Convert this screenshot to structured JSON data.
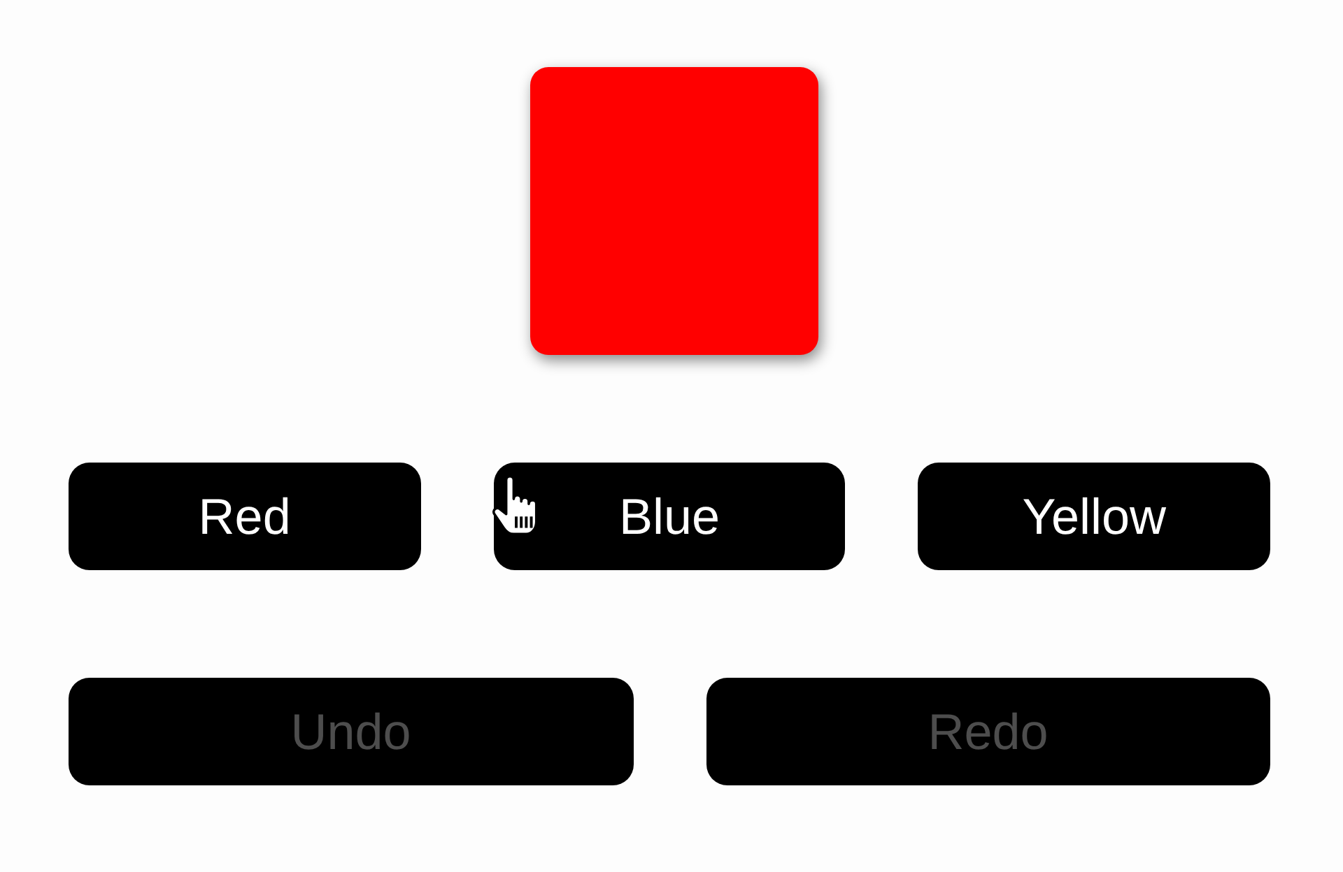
{
  "preview": {
    "color": "#ff0000"
  },
  "color_buttons": [
    {
      "label": "Red"
    },
    {
      "label": "Blue"
    },
    {
      "label": "Yellow"
    }
  ],
  "history_buttons": [
    {
      "label": "Undo",
      "disabled": true
    },
    {
      "label": "Redo",
      "disabled": true
    }
  ]
}
